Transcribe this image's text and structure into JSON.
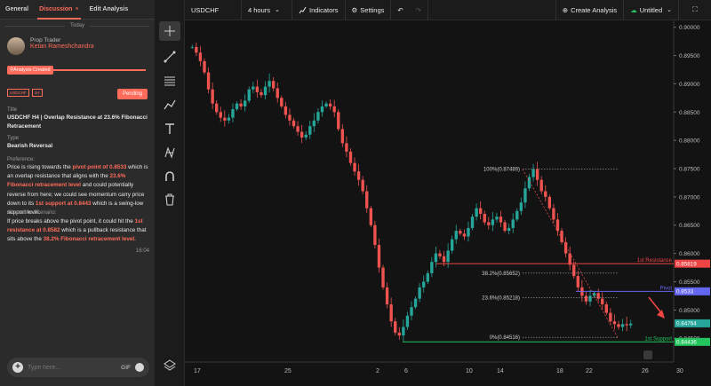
{
  "tabs": [
    {
      "label": "General"
    },
    {
      "label": "Discussion",
      "close": "×"
    },
    {
      "label": "Edit Analysis"
    }
  ],
  "divider_label": "Today",
  "author": {
    "role": "Prop Trader",
    "name": "Ketan Rameshchandra"
  },
  "status_chip": "Analysis Created",
  "badges": [
    "USDCHF",
    "1H"
  ],
  "pending_label": "Pending",
  "title_label": "Title",
  "title_value": "USDCHF H4 | Overlap Resistance at 23.6% Fibonacci Retracement",
  "type_label": "Type",
  "type_value": "Bearish Reversal",
  "preference_label": "Preference:",
  "preference_parts": [
    {
      "t": "Price is rising towards the ",
      "h": false
    },
    {
      "t": "pivot point of 0.8533",
      "h": true
    },
    {
      "t": " which is an overlap resistance that aligns with the ",
      "h": false
    },
    {
      "t": "23.6% Fibonacci retracement level",
      "h": true
    },
    {
      "t": " and could potentially reverse from here; we could see momentum carry price down to its ",
      "h": false
    },
    {
      "t": "1st support at 0.8443",
      "h": true
    },
    {
      "t": " which is a swing-low support level.",
      "h": false
    }
  ],
  "alternative_label": "Alternative Scenario:",
  "alternative_parts": [
    {
      "t": "If price breaks above the pivot point, it could hit the ",
      "h": false
    },
    {
      "t": "1st resistance at 0.8582",
      "h": true
    },
    {
      "t": " which is a pullback resistance that sits above the ",
      "h": false
    },
    {
      "t": "38.2% Fibonacci retracement level.",
      "h": true
    }
  ],
  "timestamp": "16:04",
  "compose": {
    "placeholder": "Type here...",
    "gif_label": "GIF"
  },
  "topbar": {
    "symbol": "USDCHF",
    "interval": "4 hours",
    "indicators": "Indicators",
    "settings": "Settings",
    "create_analysis": "Create Analysis",
    "layout_name": "Untitled"
  },
  "colors": {
    "accent": "#ff6b5a",
    "up": "#26a69a",
    "down": "#ef5350",
    "resistance": "#ef4444",
    "pivot": "#6366f1",
    "support": "#22c55e"
  },
  "chart_data": {
    "type": "candlestick",
    "symbol": "USDCHF",
    "interval": "4 hours",
    "y_ticks": [
      "0.90000",
      "0.89500",
      "0.89000",
      "0.88500",
      "0.88000",
      "0.87500",
      "0.87000",
      "0.86500",
      "0.86000",
      "0.85500",
      "0.85000",
      "0.84500"
    ],
    "ylim": [
      0.8408,
      0.9012
    ],
    "x_ticks": [
      "17",
      "25",
      "2",
      "6",
      "10",
      "14",
      "18",
      "22",
      "26",
      "30"
    ],
    "price_path": [
      0.8965,
      0.8955,
      0.894,
      0.892,
      0.889,
      0.8865,
      0.885,
      0.884,
      0.8835,
      0.884,
      0.8855,
      0.8865,
      0.886,
      0.887,
      0.889,
      0.8895,
      0.8885,
      0.888,
      0.8895,
      0.8905,
      0.8892,
      0.8875,
      0.886,
      0.8845,
      0.8835,
      0.8825,
      0.8815,
      0.8805,
      0.881,
      0.8825,
      0.8835,
      0.885,
      0.886,
      0.8865,
      0.886,
      0.885,
      0.882,
      0.8795,
      0.878,
      0.876,
      0.8745,
      0.873,
      0.871,
      0.868,
      0.865,
      0.8615,
      0.8575,
      0.854,
      0.851,
      0.848,
      0.846,
      0.8455,
      0.847,
      0.849,
      0.8505,
      0.852,
      0.854,
      0.855,
      0.8565,
      0.8585,
      0.86,
      0.8595,
      0.8585,
      0.8605,
      0.8625,
      0.864,
      0.8635,
      0.863,
      0.8645,
      0.8665,
      0.868,
      0.867,
      0.8655,
      0.865,
      0.866,
      0.8665,
      0.8655,
      0.864,
      0.8645,
      0.866,
      0.8675,
      0.869,
      0.8715,
      0.8735,
      0.8749,
      0.873,
      0.871,
      0.87,
      0.868,
      0.866,
      0.864,
      0.862,
      0.86,
      0.858,
      0.856,
      0.854,
      0.8525,
      0.8515,
      0.8525,
      0.853,
      0.852,
      0.851,
      0.8495,
      0.848,
      0.8475,
      0.847,
      0.8475,
      0.8473,
      0.8476
    ],
    "x_range": [
      0,
      108
    ],
    "fib_anchor_low": 0.84516,
    "fib_anchor_high": 0.87489,
    "fib_levels": [
      {
        "label": "100%(0.87489)",
        "value": 0.87489
      },
      {
        "label": "38.2%(0.85652)",
        "value": 0.85652
      },
      {
        "label": "23.6%(0.85218)",
        "value": 0.85218
      },
      {
        "label": "0%(0.84516)",
        "value": 0.84516
      }
    ],
    "levels": [
      {
        "name": "1st Resistance",
        "value": 0.85819,
        "tag": "0.85819",
        "color": "#ef4444"
      },
      {
        "name": "Pivot",
        "value": 0.8533,
        "tag": "0.8533",
        "color": "#6366f1"
      },
      {
        "name": "1st Support",
        "value": 0.84436,
        "tag": "0.84436",
        "color": "#22c55e"
      }
    ],
    "current_price": "0.84764"
  }
}
